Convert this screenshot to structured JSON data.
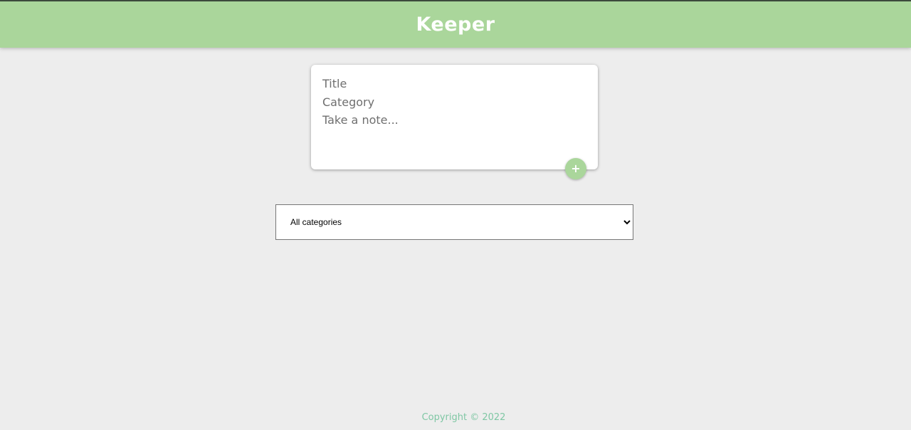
{
  "header": {
    "title": "Keeper"
  },
  "note_form": {
    "title_placeholder": "Title",
    "category_placeholder": "Category",
    "content_placeholder": "Take a note...",
    "add_icon": "plus-icon",
    "add_symbol": "+"
  },
  "filter": {
    "selected": "All categories",
    "options": [
      "All categories"
    ]
  },
  "footer": {
    "text": "Copyright © 2022"
  },
  "colors": {
    "header_bg": "#aad69b",
    "page_bg": "#ededed",
    "footer_text": "#7fc7a4",
    "accent": "#aad69b"
  }
}
